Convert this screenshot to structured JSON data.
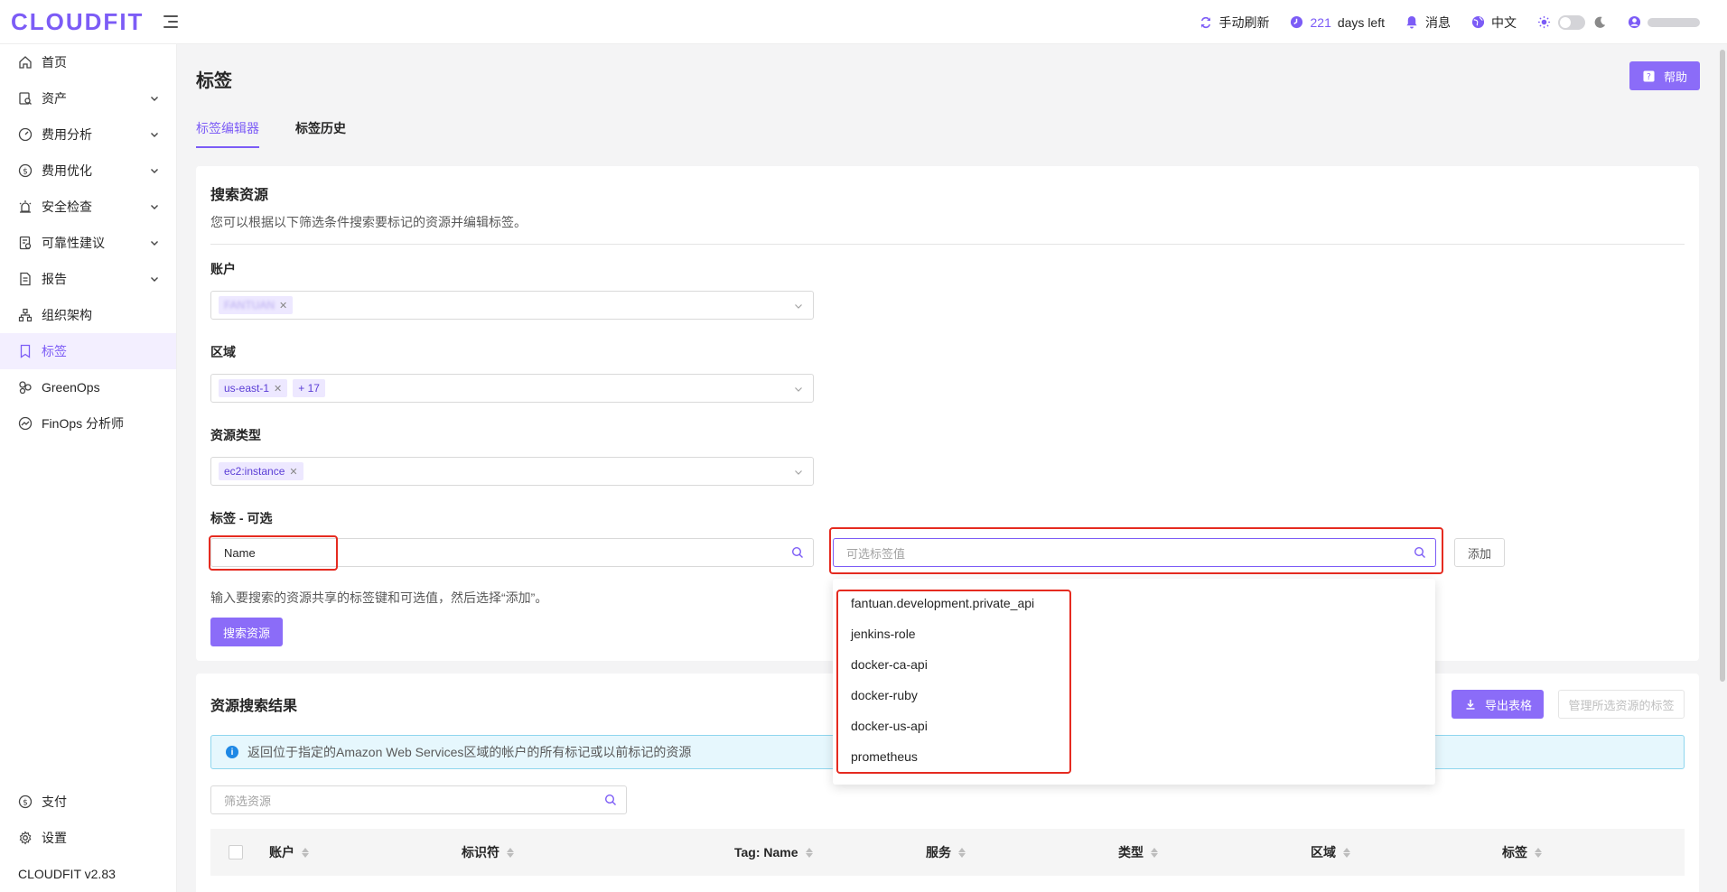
{
  "app": {
    "logo": "CLOUDFIT"
  },
  "topbar": {
    "refresh_label": "手动刷新",
    "days_number": "221",
    "days_suffix": "days left",
    "messages_label": "消息",
    "language_label": "中文"
  },
  "sidebar": {
    "items": [
      {
        "label": "首页",
        "icon": "home-icon",
        "expandable": false
      },
      {
        "label": "资产",
        "icon": "asset-icon",
        "expandable": true
      },
      {
        "label": "费用分析",
        "icon": "dashboard-icon",
        "expandable": true
      },
      {
        "label": "费用优化",
        "icon": "dollar-icon",
        "expandable": true
      },
      {
        "label": "安全检查",
        "icon": "alarm-icon",
        "expandable": true
      },
      {
        "label": "可靠性建议",
        "icon": "checklist-icon",
        "expandable": true
      },
      {
        "label": "报告",
        "icon": "report-icon",
        "expandable": true
      },
      {
        "label": "组织架构",
        "icon": "org-icon",
        "expandable": false
      },
      {
        "label": "标签",
        "icon": "tag-icon",
        "expandable": false,
        "active": true
      },
      {
        "label": "GreenOps",
        "icon": "leaf-icon",
        "expandable": false
      },
      {
        "label": "FinOps 分析师",
        "icon": "analyst-icon",
        "expandable": false
      }
    ],
    "bottom": {
      "pay_label": "支付",
      "settings_label": "设置",
      "version": "CLOUDFIT v2.83"
    }
  },
  "page": {
    "title": "标签",
    "help_label": "帮助",
    "tabs": [
      {
        "label": "标签编辑器",
        "active": true
      },
      {
        "label": "标签历史",
        "active": false
      }
    ]
  },
  "search": {
    "title": "搜索资源",
    "subtitle": "您可以根据以下筛选条件搜索要标记的资源并编辑标签。",
    "account_label": "账户",
    "account_chip": "FANTUAN",
    "region_label": "区域",
    "region_chip": "us-east-1",
    "region_more": "+ 17",
    "resource_type_label": "资源类型",
    "resource_type_chip": "ec2:instance",
    "tag_label": "标签 - 可选",
    "tag_key_value": "Name",
    "tag_value_placeholder": "可选标签值",
    "add_label": "添加",
    "hint": "输入要搜索的资源共享的标签键和可选值，然后选择“添加”。",
    "search_button": "搜索资源",
    "dropdown_options": [
      "fantuan.development.private_api",
      "jenkins-role",
      "docker-ca-api",
      "docker-ruby",
      "docker-us-api",
      "prometheus"
    ]
  },
  "results": {
    "title": "资源搜索结果",
    "export_label": "导出表格",
    "manage_label": "管理所选资源的标签",
    "info": "返回位于指定的Amazon Web Services区域的帐户的所有标记或以前标记的资源",
    "filter_placeholder": "筛选资源",
    "columns": [
      "账户",
      "标识符",
      "Tag: Name",
      "服务",
      "类型",
      "区域",
      "标签"
    ]
  },
  "colors": {
    "accent": "#7c5cf6",
    "highlight": "#e52b20"
  }
}
